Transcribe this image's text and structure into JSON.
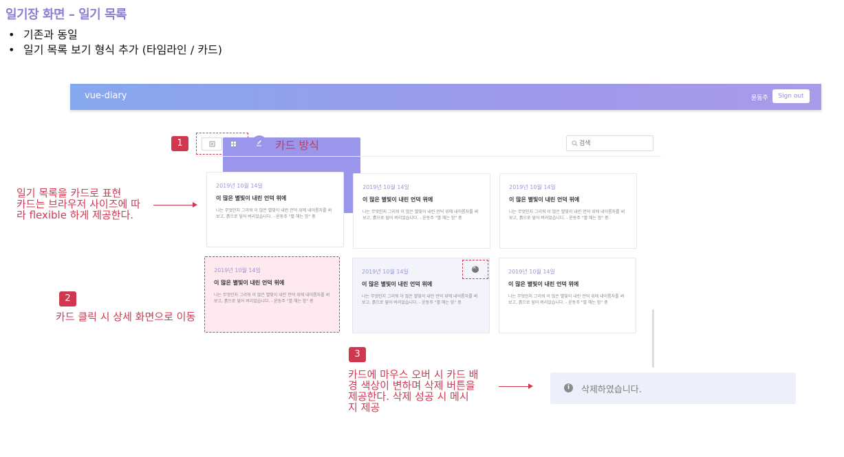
{
  "doc": {
    "title": "일기장 화면 – 일기 목록",
    "bullets": [
      "기존과 동일",
      "일기 목록 보기 형식 추가 (타임라인 / 카드)"
    ]
  },
  "navbar": {
    "brand": "vue-diary",
    "user": "윤동주",
    "sign_out_label": "Sign out"
  },
  "toolbar": {
    "mode_label": "카드 방식",
    "search_placeholder": "검색"
  },
  "cards": [
    {
      "date": "2019년 10월 14일",
      "title": "이 많은 별빛이 내린 언덕 위에",
      "body": "나는 무엇인지 그리워 이 많은 별빛이 내린 언덕 위에 내이름자를 써 보고, 흙으로 덮어 버리었습니다. - 윤동주 \"별 헤는 밤\" 중",
      "state": "normal"
    },
    {
      "date": "2019년 10월 14일",
      "title": "이 많은 별빛이 내린 언덕 위에",
      "body": "나는 무엇인지 그리워 이 많은 별빛이 내린 언덕 위에 내이름자를 써 보고, 흙으로 덮어 버리었습니다. - 윤동주 \"별 헤는 밤\" 중",
      "state": "normal"
    },
    {
      "date": "2019년 10월 14일",
      "title": "이 많은 별빛이 내린 언덕 위에",
      "body": "나는 무엇인지 그리워 이 많은 별빛이 내린 언덕 위에 내이름자를 써 보고, 흙으로 덮어 버리었습니다. - 윤동주 \"별 헤는 밤\" 중",
      "state": "normal"
    },
    {
      "date": "2019년 10월 14일",
      "title": "이 많은 별빛이 내린 언덕 위에",
      "body": "나는 무엇인지 그리워 이 많은 별빛이 내린 언덕 위에 내이름자를 써 보고, 흙으로 덮어 버리었습니다. - 윤동주 \"별 헤는 밤\" 중",
      "state": "clicked"
    },
    {
      "date": "2019년 10월 14일",
      "title": "이 많은 별빛이 내린 언덕 위에",
      "body": "나는 무엇인지 그리워 이 많은 별빛이 내린 언덕 위에 내이름자를 써 보고, 흙으로 덮어 버리었습니다. - 윤동주 \"별 헤는 밤\" 중",
      "state": "hover"
    },
    {
      "date": "2019년 10월 14일",
      "title": "이 많은 별빛이 내린 언덕 위에",
      "body": "나는 무엇인지 그리워 이 많은 별빛이 내린 언덕 위에 내이름자를 써 보고, 흙으로 덮어 버리었습니다. - 윤동주 \"별 헤는 밤\" 중",
      "state": "normal"
    }
  ],
  "toast": {
    "message": "삭제하였습니다."
  },
  "annotations": {
    "n1": "1",
    "n2": "2",
    "n3": "3",
    "card_layout": [
      "일기 목록을 카드로 표현",
      "카드는 브라우저 사이즈에 따",
      "라 flexible 하게 제공한다."
    ],
    "card_click": "카드 클릭 시 상세 화면으로 이동",
    "card_hover": [
      "카드에 마우스 오버 시 카드 배",
      "경 색상이 변하며 삭제 버튼을",
      "제공한다. 삭제 성공 시 메시",
      "지 제공"
    ]
  },
  "colors": {
    "accent": "#9a96ec",
    "annotation": "#d1374f",
    "nav_start": "#86a8ee",
    "nav_end": "#a99be9"
  }
}
